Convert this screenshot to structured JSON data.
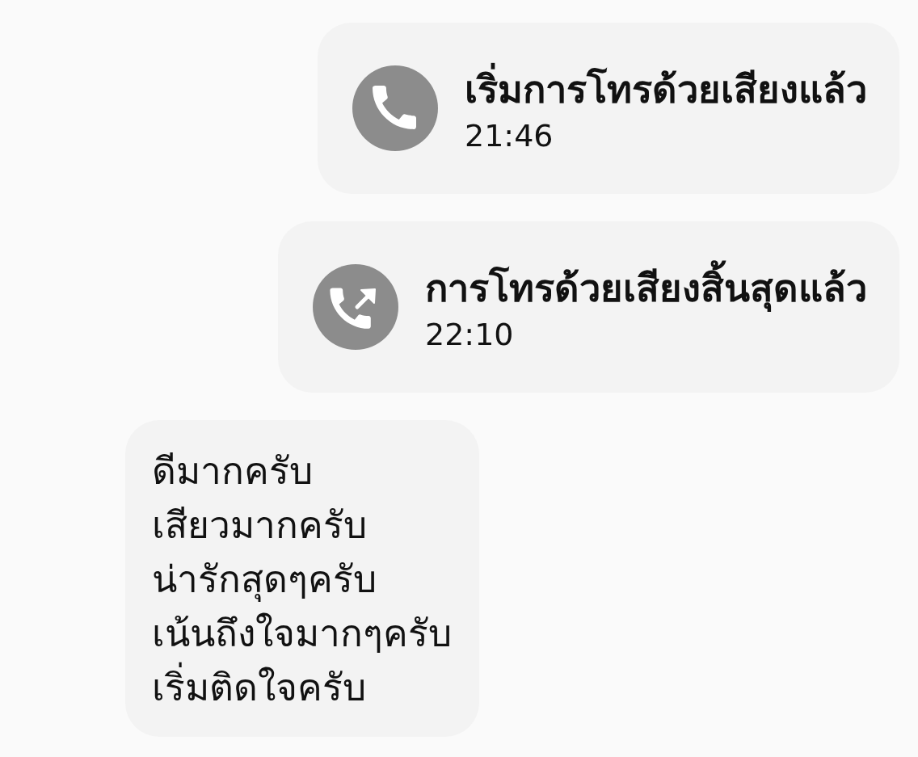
{
  "messages": [
    {
      "kind": "call_started",
      "title": "เริ่มการโทรด้วยเสียงแล้ว",
      "time": "21:46"
    },
    {
      "kind": "call_ended",
      "title": "การโทรด้วยเสียงสิ้นสุดแล้ว",
      "time": "22:10"
    },
    {
      "kind": "text",
      "text": "ดีมากครับ\nเสียวมากครับ\nน่ารักสุดๆครับ\nเน้นถึงใจมากๆครับ\nเริ่มติดใจครับ"
    }
  ]
}
